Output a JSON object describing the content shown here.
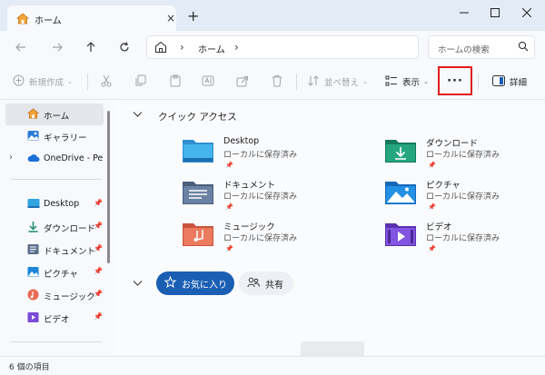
{
  "tab": {
    "title": "ホーム",
    "new_tab_symbol": "+",
    "close_symbol": "×"
  },
  "window_controls": {
    "minimize": "—",
    "maximize": "□",
    "close": "✕"
  },
  "address": {
    "crumb": "ホーム",
    "separator": "›"
  },
  "search": {
    "placeholder": "ホームの検索"
  },
  "toolbar": {
    "new_label": "新規作成",
    "sort_label": "並べ替え",
    "view_label": "表示",
    "more_label": "···",
    "details_label": "詳細"
  },
  "sidebar": {
    "home": "ホーム",
    "gallery": "ギャラリー",
    "onedrive": "OneDrive - Perso",
    "pinned": [
      {
        "label": "Desktop",
        "icon": "desktop-icon"
      },
      {
        "label": "ダウンロード",
        "icon": "downloads-icon"
      },
      {
        "label": "ドキュメント",
        "icon": "documents-icon"
      },
      {
        "label": "ピクチャ",
        "icon": "pictures-icon"
      },
      {
        "label": "ミュージック",
        "icon": "music-icon"
      },
      {
        "label": "ビデオ",
        "icon": "videos-icon"
      }
    ]
  },
  "quick_access": {
    "title": "クイック アクセス",
    "items": [
      {
        "name": "Desktop",
        "sub": "ローカルに保存済み"
      },
      {
        "name": "ダウンロード",
        "sub": "ローカルに保存済み"
      },
      {
        "name": "ドキュメント",
        "sub": "ローカルに保存済み"
      },
      {
        "name": "ピクチャ",
        "sub": "ローカルに保存済み"
      },
      {
        "name": "ミュージック",
        "sub": "ローカルに保存済み"
      },
      {
        "name": "ビデオ",
        "sub": "ローカルに保存済み"
      }
    ]
  },
  "filters": {
    "favorites": "お気に入り",
    "shared": "共有"
  },
  "status": {
    "count": "6 個の項目"
  },
  "colors": {
    "accent": "#1a5fb4",
    "highlight_border": "#e21b1b"
  }
}
